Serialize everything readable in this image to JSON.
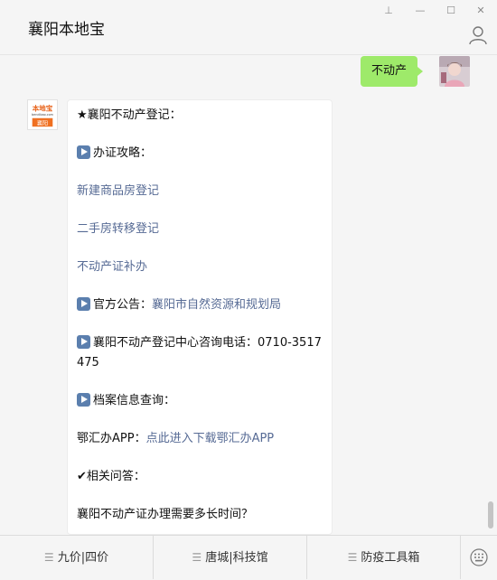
{
  "app": {
    "title": "襄阳本地宝"
  },
  "window_controls": {
    "pin": "⊥",
    "minimize": "—",
    "maximize": "☐",
    "close": "✕"
  },
  "outgoing": {
    "text": "不动产"
  },
  "bot_avatar": {
    "brand": "本地宝",
    "domain": "bendibao.com",
    "city": "襄阳"
  },
  "reply": {
    "heading": "★襄阳不动产登记：",
    "guide_label": "办证攻略：",
    "link_new_house": "新建商品房登记",
    "link_second_hand": "二手房转移登记",
    "link_reissue": "不动产证补办",
    "notice_label": "官方公告：",
    "notice_link": "襄阳市自然资源和规划局",
    "phone_text": "襄阳不动产登记中心咨询电话：0710-3517475",
    "archive_label": "档案信息查询：",
    "app_label": "鄂汇办APP：",
    "app_link": "点此进入下载鄂汇办APP",
    "faq_heading": "✔相关问答：",
    "faq_question": "襄阳不动产证办理需要多长时间？"
  },
  "bottom_menu": {
    "items": [
      {
        "label": "九价|四价",
        "icon": "menu-lines-icon"
      },
      {
        "label": "唐城|科技馆",
        "icon": "menu-lines-icon"
      },
      {
        "label": "防疫工具箱",
        "icon": "menu-lines-icon"
      }
    ],
    "menu_glyph": "☰"
  },
  "colors": {
    "link": "#576b95",
    "outgoing_bubble": "#9eea6a",
    "background": "#f5f5f5"
  }
}
